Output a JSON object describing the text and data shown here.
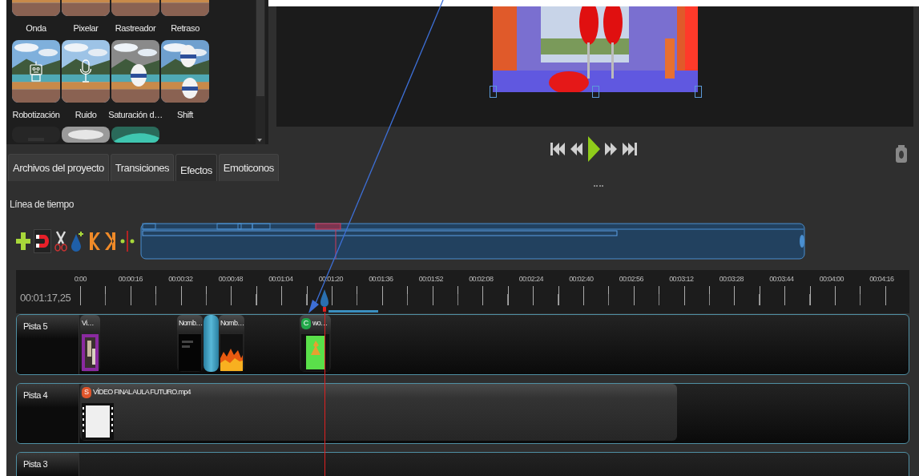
{
  "effects": [
    {
      "kind": "effect",
      "label": "Onda"
    },
    {
      "kind": "effect",
      "label": "Pixelar"
    },
    {
      "kind": "effect",
      "label": "Rastreador"
    },
    {
      "kind": "effect",
      "label": "Retraso"
    },
    {
      "kind": "effect",
      "label": "Robotización"
    },
    {
      "kind": "effect",
      "label": "Ruido"
    },
    {
      "kind": "effect",
      "label": "Saturación d…"
    },
    {
      "kind": "effect",
      "label": "Shift"
    },
    {
      "kind": "partial"
    },
    {
      "kind": "partial"
    },
    {
      "kind": "partial"
    }
  ],
  "panel_tabs": [
    {
      "label": "Archivos del proyecto",
      "selected": false
    },
    {
      "label": "Transiciones",
      "selected": false
    },
    {
      "label": "Efectos",
      "selected": true
    },
    {
      "label": "Emoticonos",
      "selected": false
    }
  ],
  "timeline": {
    "title": "Línea de tiempo",
    "current_time": "00:01:17,25",
    "ruler_labels": [
      "0:00",
      "00:00:16",
      "00:00:32",
      "00:00:48",
      "00:01:04",
      "00:01:20",
      "00:01:36",
      "00:01:52",
      "00:02:08",
      "00:02:24",
      "00:02:40",
      "00:02:56",
      "00:03:12",
      "00:03:28",
      "00:03:44",
      "00:04:00",
      "00:04:16"
    ],
    "tracks": [
      {
        "name": "Pista 5",
        "clips": [
          {
            "kind": "clip",
            "title": "Vi…"
          },
          {
            "kind": "clip",
            "title": "Nomb…"
          },
          {
            "kind": "transition"
          },
          {
            "kind": "clip",
            "title": "Nomb…"
          },
          {
            "kind": "clip",
            "title": "wo…",
            "badge": "C",
            "color": "#22a84a"
          }
        ]
      },
      {
        "name": "Pista 4",
        "clips": [
          {
            "kind": "clip",
            "title": "VÍDEO FINAL AULA FUTURO.mp4",
            "badge": "S",
            "color": "#e0552b"
          }
        ]
      },
      {
        "name": "Pista 3"
      }
    ]
  }
}
